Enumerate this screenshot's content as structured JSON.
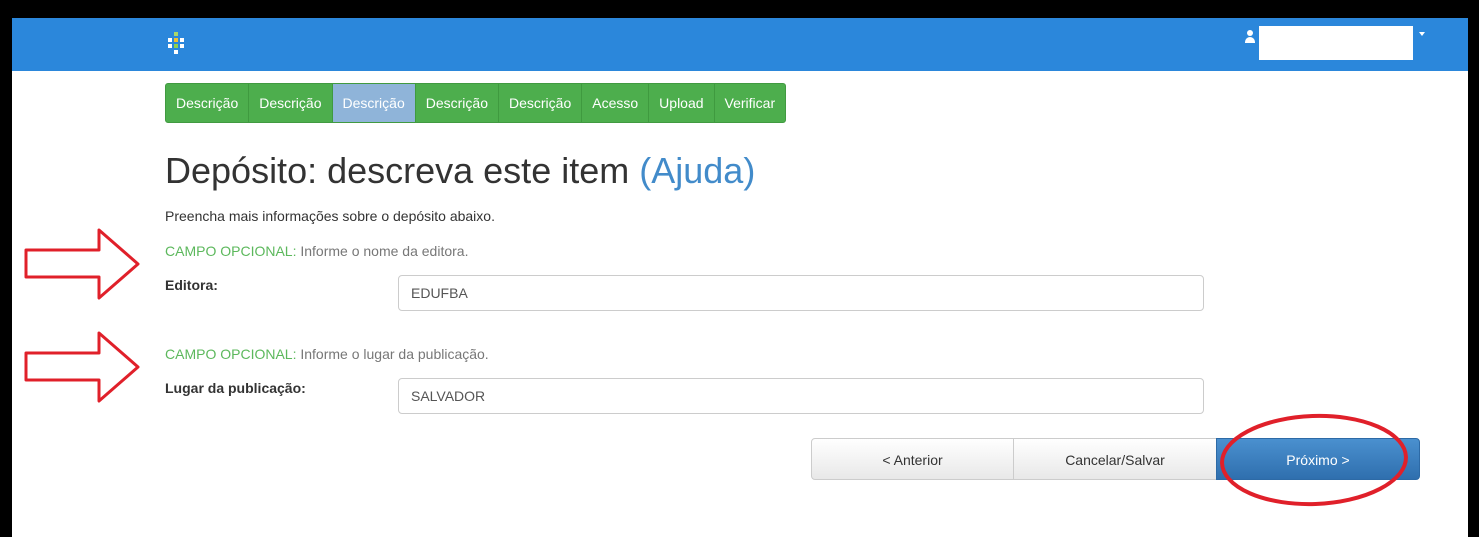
{
  "navbar": {
    "logo_icon": "dspace-logo-icon",
    "user_icon": "user-icon",
    "dropdown_icon": "caret-down-icon",
    "background_color": "#2b87db"
  },
  "tabs": [
    {
      "label": "Descrição",
      "active": false
    },
    {
      "label": "Descrição",
      "active": false
    },
    {
      "label": "Descrição",
      "active": true
    },
    {
      "label": "Descrição",
      "active": false
    },
    {
      "label": "Descrição",
      "active": false
    },
    {
      "label": "Acesso",
      "active": false
    },
    {
      "label": "Upload",
      "active": false
    },
    {
      "label": "Verificar",
      "active": false
    }
  ],
  "page": {
    "title": "Depósito: descreva este item",
    "help_link": "(Ajuda)",
    "intro": "Preencha mais informações sobre o depósito abaixo."
  },
  "fields": [
    {
      "hint_prefix": "CAMPO OPCIONAL:",
      "hint_text": " Informe o nome da editora.",
      "label": "Editora:",
      "value": "EDUFBA"
    },
    {
      "hint_prefix": "CAMPO OPCIONAL:",
      "hint_text": " Informe o lugar da publicação.",
      "label": "Lugar da publicação:",
      "value": "SALVADOR"
    }
  ],
  "buttons": {
    "previous": "< Anterior",
    "cancel_save": "Cancelar/Salvar",
    "next": "Próximo >"
  },
  "annotations": {
    "color": "#e0202a",
    "marks": [
      "right-arrow",
      "right-arrow",
      "circle"
    ]
  }
}
